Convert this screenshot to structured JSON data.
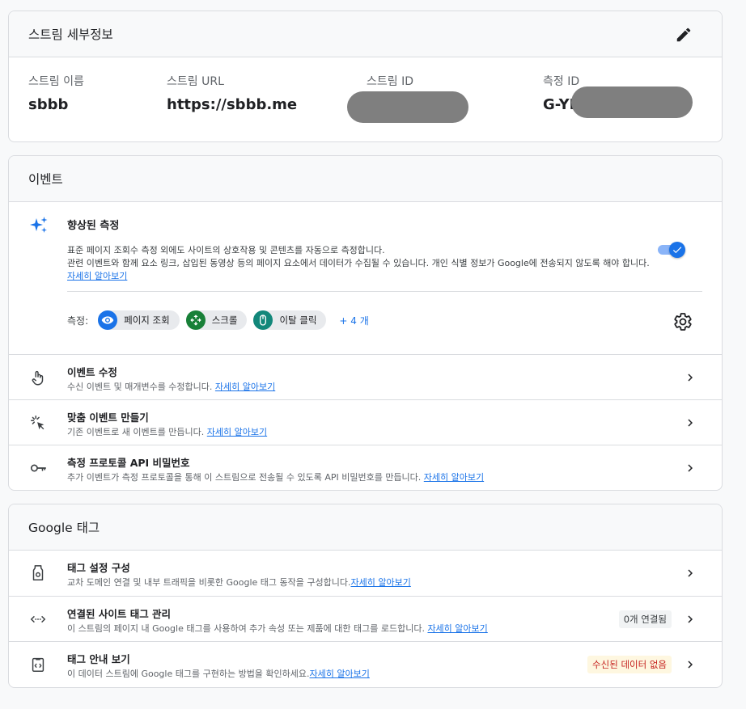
{
  "stream": {
    "header": "스트림 세부정보",
    "name_label": "스트림 이름",
    "name_value": "sbbb",
    "url_label": "스트림 URL",
    "url_value": "https://sbbb.me",
    "id_label": "스트림 ID",
    "measure_label": "측정 ID",
    "measure_value": "G-YI"
  },
  "events": {
    "header": "이벤트",
    "enhanced": {
      "title": "향상된 측정",
      "desc_line1": "표준 페이지 조회수 측정 외에도 사이트의 상호작용 및 콘텐츠를 자동으로 측정합니다.",
      "desc_line2": "관련 이벤트와 함께 요소 링크, 삽입된 동영상 등의 페이지 요소에서 데이터가 수집될 수 있습니다. 개인 식별 정보가 Google에 전송되지 않도록 해야 합니다.",
      "learn_more": "자세히 알아보기",
      "toggle_on": true,
      "measure_label": "측정:",
      "chips": [
        {
          "label": "페이지 조회",
          "icon": "eye-icon",
          "color": "#1a73e8"
        },
        {
          "label": "스크롤",
          "icon": "scroll-icon",
          "color": "#188038"
        },
        {
          "label": "이탈 클릭",
          "icon": "mouse-icon",
          "color": "#12877a"
        }
      ],
      "more": "+ 4 개"
    },
    "rows": [
      {
        "title": "이벤트 수정",
        "sub": "수신 이벤트 및 매개변수를 수정합니다. ",
        "link": "자세히 알아보기"
      },
      {
        "title": "맞춤 이벤트 만들기",
        "sub": "기존 이벤트로 새 이벤트를 만듭니다. ",
        "link": "자세히 알아보기"
      },
      {
        "title": "측정 프로토콜 API 비밀번호",
        "sub": "추가 이벤트가 측정 프로토콜을 통해 이 스트림으로 전송될 수 있도록 API 비밀번호를 만듭니다. ",
        "link": "자세히 알아보기"
      }
    ]
  },
  "gtag": {
    "header": "Google 태그",
    "rows": [
      {
        "title": "태그 설정 구성",
        "sub": "교차 도메인 연결 및 내부 트래픽을 비롯한 Google 태그 동작을 구성합니다.",
        "link": "자세히 알아보기"
      },
      {
        "title": "연결된 사이트 태그 관리",
        "sub": "이 스트림의 페이지 내 Google 태그를 사용하여 추가 속성 또는 제품에 대한 태그를 로드합니다. ",
        "link": "자세히 알아보기",
        "badge": "0개 연결됨"
      },
      {
        "title": "태그 안내 보기",
        "sub": "이 데이터 스트림에 Google 태그를 구현하는 방법을 확인하세요.",
        "link": "자세히 알아보기",
        "badge": "수신된 데이터 없음"
      }
    ]
  },
  "colors": {
    "accent": "#1a73e8",
    "warning_text": "#c5221f",
    "warning_bg": "#fef7e0"
  }
}
